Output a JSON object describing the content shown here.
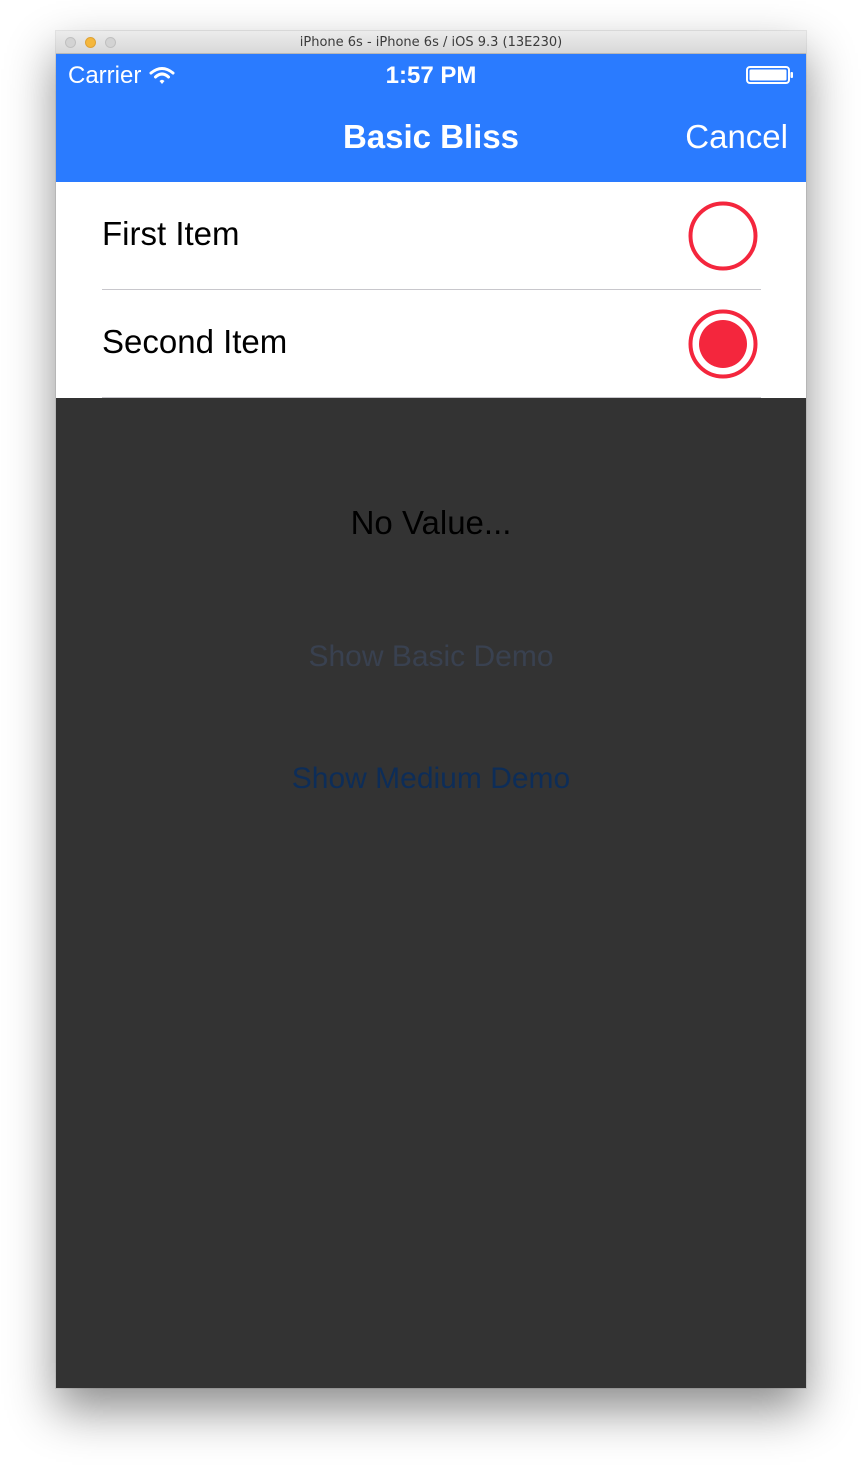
{
  "window": {
    "title": "iPhone 6s - iPhone 6s / iOS 9.3 (13E230)"
  },
  "status_bar": {
    "carrier": "Carrier",
    "time": "1:57 PM"
  },
  "nav_bar": {
    "title": "Basic Bliss",
    "cancel_label": "Cancel"
  },
  "options": [
    {
      "label": "First Item",
      "selected": false
    },
    {
      "label": "Second Item",
      "selected": true
    }
  ],
  "background": {
    "value_label": "No Value...",
    "show_basic_demo": "Show Basic Demo",
    "show_medium_demo": "Show Medium Demo"
  },
  "colors": {
    "nav_bar": "#2a7bff",
    "radio_accent": "#f4263d",
    "dimmed_background": "#333333"
  },
  "icons": [
    "wifi-icon",
    "battery-icon",
    "radio-unselected-icon",
    "radio-selected-icon"
  ]
}
